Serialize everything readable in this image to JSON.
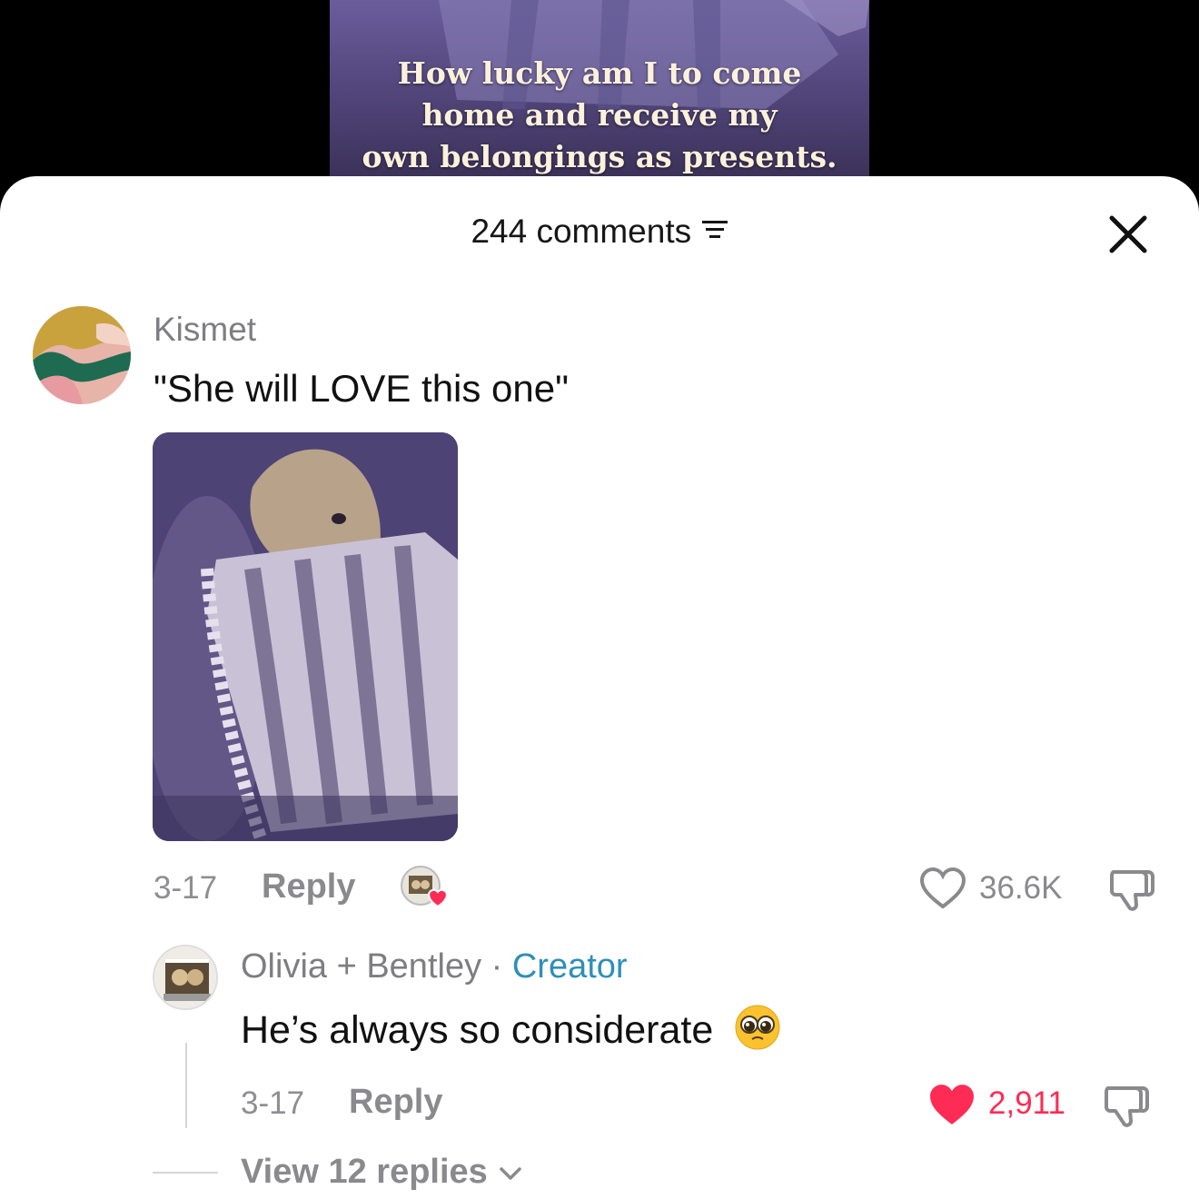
{
  "video": {
    "caption": "How lucky am I to come\nhome and receive my\nown belongings as presents."
  },
  "sheet": {
    "comment_count": "244 comments"
  },
  "comments": [
    {
      "username": "Kismet",
      "text": "\"She will LOVE this one\"",
      "date": "3-17",
      "reply_label": "Reply",
      "likes": "36.6K"
    }
  ],
  "replies": [
    {
      "username": "Olivia + Bentley",
      "separator": " · ",
      "badge": "Creator",
      "text": "He’s always so considerate",
      "emoji": "🥹",
      "date": "3-17",
      "reply_label": "Reply",
      "likes": "2,911"
    }
  ],
  "view_replies": "View 12 replies",
  "colors": {
    "liked_heart": "#fe2c55",
    "creator_badge": "#2f8fb8"
  }
}
